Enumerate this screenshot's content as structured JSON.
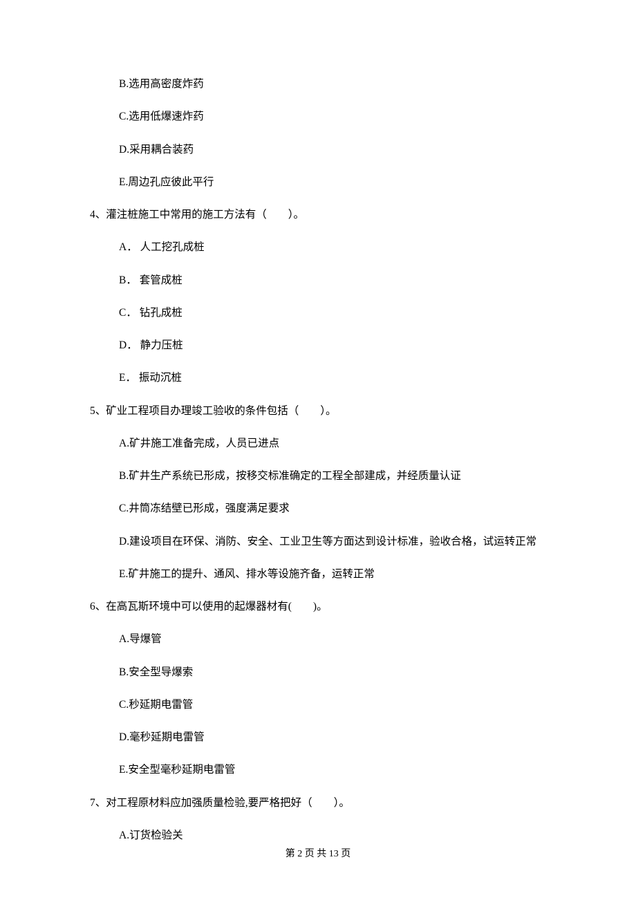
{
  "q3_partial": {
    "options": {
      "B": "B.选用高密度炸药",
      "C": "C.选用低爆速炸药",
      "D": "D.采用耦合装药",
      "E": "E.周边孔应彼此平行"
    }
  },
  "q4": {
    "stem": "4、灌注桩施工中常用的施工方法有（　　）。",
    "options": {
      "A": "A． 人工挖孔成桩",
      "B": "B． 套管成桩",
      "C": "C． 钻孔成桩",
      "D": "D． 静力压桩",
      "E": "E． 振动沉桩"
    }
  },
  "q5": {
    "stem": "5、矿业工程项目办理竣工验收的条件包括（　　）。",
    "options": {
      "A": "A.矿井施工准备完成，人员已进点",
      "B": "B.矿井生产系统已形成，按移交标准确定的工程全部建成，并经质量认证",
      "C": "C.井筒冻结壁已形成，强度满足要求",
      "D": "D.建设项目在环保、消防、安全、工业卫生等方面达到设计标准，验收合格，试运转正常",
      "E": "E.矿井施工的提升、通风、排水等设施齐备，运转正常"
    }
  },
  "q6": {
    "stem": "6、在高瓦斯环境中可以使用的起爆器材有(　　)。",
    "options": {
      "A": "A.导爆管",
      "B": "B.安全型导爆索",
      "C": "C.秒延期电雷管",
      "D": "D.毫秒延期电雷管",
      "E": "E.安全型毫秒延期电雷管"
    }
  },
  "q7": {
    "stem": "7、对工程原材料应加强质量检验,要严格把好（　　）。",
    "options": {
      "A": "A.订货检验关"
    }
  },
  "footer": "第 2 页 共 13 页"
}
